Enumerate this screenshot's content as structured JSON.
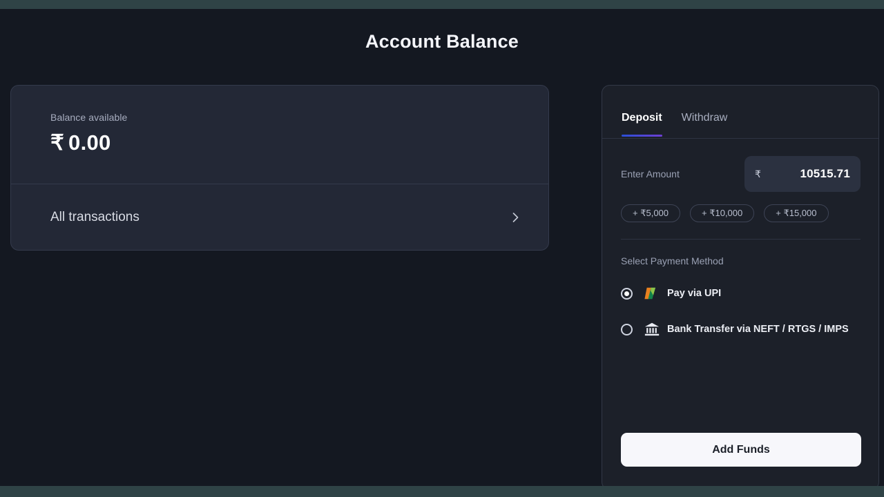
{
  "page": {
    "title": "Account Balance"
  },
  "balance_card": {
    "label": "Balance available",
    "currency": "₹",
    "amount": "0.00",
    "all_transactions_label": "All transactions",
    "chevron_icon": "chevron-right-icon"
  },
  "deposit_panel": {
    "tabs": [
      {
        "label": "Deposit",
        "active": true
      },
      {
        "label": "Withdraw",
        "active": false
      }
    ],
    "amount": {
      "label": "Enter Amount",
      "currency": "₹",
      "value": "10515.71",
      "placeholder": "0"
    },
    "quick_amounts": [
      {
        "label": "+ ₹5,000"
      },
      {
        "label": "+ ₹10,000"
      },
      {
        "label": "+ ₹15,000"
      }
    ],
    "payment_methods": {
      "title": "Select Payment Method",
      "options": [
        {
          "label": "Pay via UPI",
          "icon": "upi-logo-icon",
          "selected": true
        },
        {
          "label": "Bank Transfer via NEFT / RTGS / IMPS",
          "icon": "bank-building-icon",
          "selected": false
        }
      ]
    },
    "submit_label": "Add Funds"
  },
  "colors": {
    "page_background": "#141821",
    "chrome": "#2f4346",
    "card_background": "#232836",
    "panel_background": "#1c2029",
    "accent_gradient_start": "#2b4fd6",
    "accent_gradient_end": "#6d3fd4",
    "primary_button": "#f7f7fb",
    "upi_orange": "#e8811f",
    "upi_green": "#14834a",
    "muted_text": "#9aa1b4"
  }
}
